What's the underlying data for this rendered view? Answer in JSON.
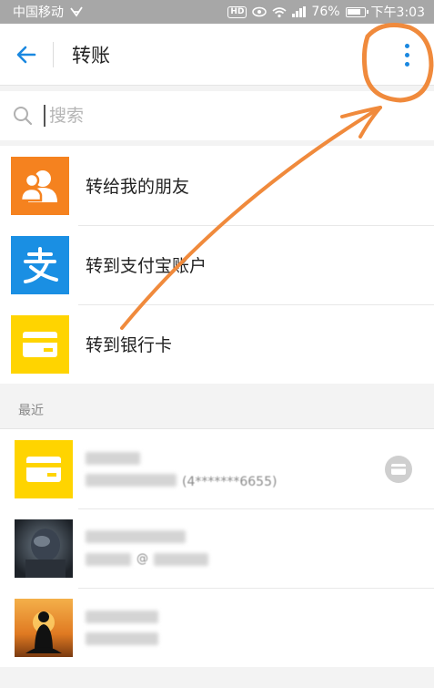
{
  "status_bar": {
    "carrier": "中国移动",
    "battery": "76%",
    "time": "下午3:03",
    "hd_badge": "HD"
  },
  "header": {
    "title": "转账",
    "back_icon": "back-arrow-icon",
    "more_icon": "more-vertical-icon"
  },
  "search": {
    "placeholder": "搜索",
    "icon": "search-icon"
  },
  "options": [
    {
      "label": "转给我的朋友",
      "icon": "friends-icon",
      "color": "#f5821f"
    },
    {
      "label": "转到支付宝账户",
      "icon": "alipay-icon",
      "color": "#1a8fe3"
    },
    {
      "label": "转到银行卡",
      "icon": "bank-card-icon",
      "color": "#ffd400"
    }
  ],
  "recent": {
    "section_label": "最近",
    "items": [
      {
        "avatar": "bank-card-icon",
        "account_tail": "(4*******6655)"
      },
      {
        "avatar": "photo-avatar",
        "account_tail": "@"
      },
      {
        "avatar": "silhouette-avatar"
      }
    ]
  },
  "colors": {
    "accent": "#1a88e0",
    "annotation": "#f08a3c"
  }
}
